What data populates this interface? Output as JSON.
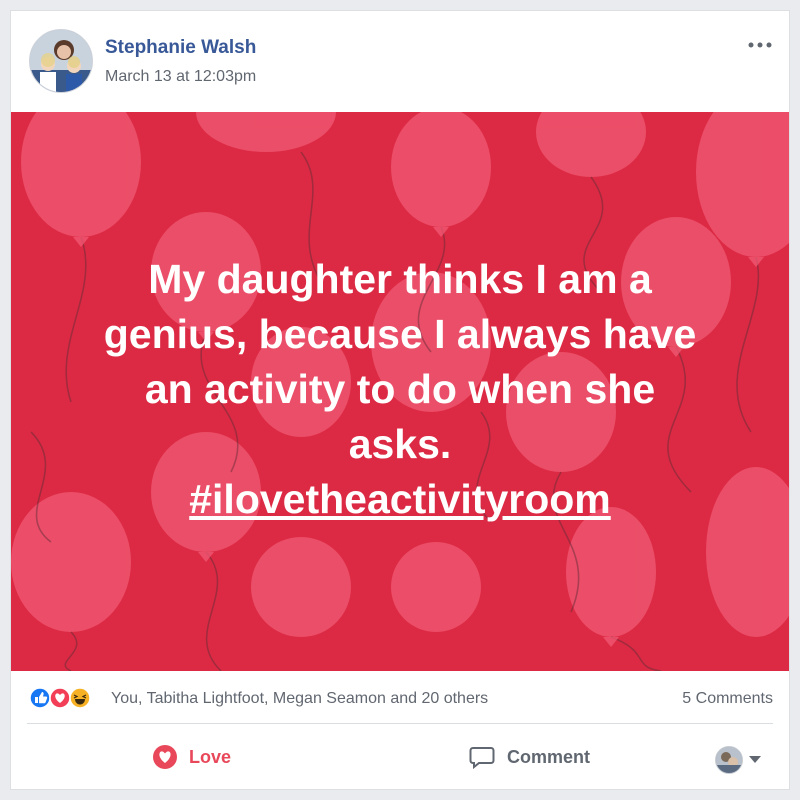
{
  "post": {
    "author": "Stephanie Walsh",
    "timestamp": "March 13 at 12:03pm",
    "text_lines": [
      "My daughter thinks I am a",
      "genius, because I always have",
      "an activity to do when she",
      "asks."
    ],
    "hashtag": "#ilovetheactivityroom",
    "image_background_color": "#dd2a44",
    "balloon_color": "#f05a74"
  },
  "reactions": {
    "icons": [
      "like-icon",
      "love-icon",
      "haha-icon"
    ],
    "names": "You, Tabitha Lightfoot, Megan Seamon and 20 others",
    "comments": "5 Comments"
  },
  "actions": {
    "love_label": "Love",
    "comment_label": "Comment",
    "love_color": "#e8485a"
  }
}
